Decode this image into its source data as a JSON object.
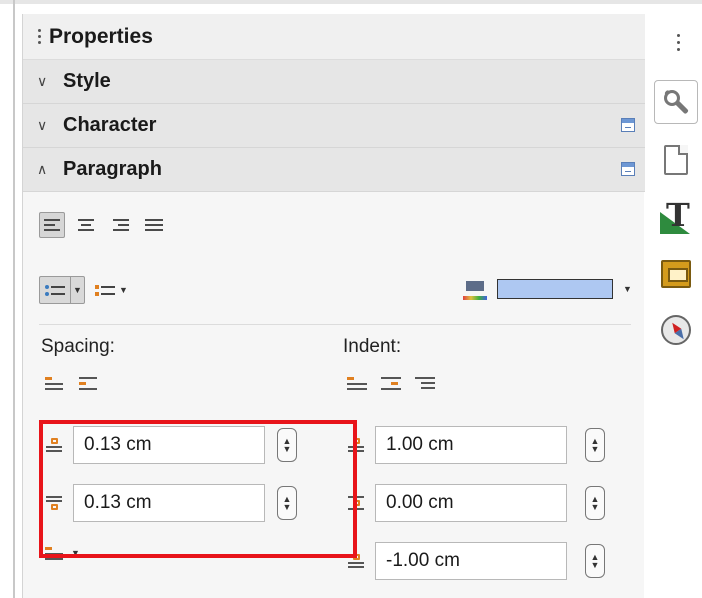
{
  "panel": {
    "title": "Properties"
  },
  "sections": [
    {
      "label": "Style",
      "chevron": "chevron-down-icon",
      "expanded": false
    },
    {
      "label": "Character",
      "chevron": "chevron-down-icon",
      "expanded": false
    },
    {
      "label": "Paragraph",
      "chevron": "chevron-up-icon",
      "expanded": true
    }
  ],
  "paragraph": {
    "alignment_buttons": [
      "align-left-icon",
      "align-center-icon",
      "align-right-icon",
      "align-justify-icon"
    ],
    "active_alignment": "align-left-icon",
    "background_color": "#aec8f2",
    "spacing": {
      "heading": "Spacing:",
      "above": "0.13 cm",
      "below": "0.13 cm"
    },
    "indent": {
      "heading": "Indent:",
      "before_text": "1.00 cm",
      "after_text": "0.00 cm",
      "first_line": "-1.00 cm"
    }
  },
  "highlight_color": "#e8141a",
  "sidebar_tabs": [
    "properties-wrench-icon",
    "page-icon",
    "styles-icon",
    "gallery-icon",
    "navigator-icon"
  ]
}
